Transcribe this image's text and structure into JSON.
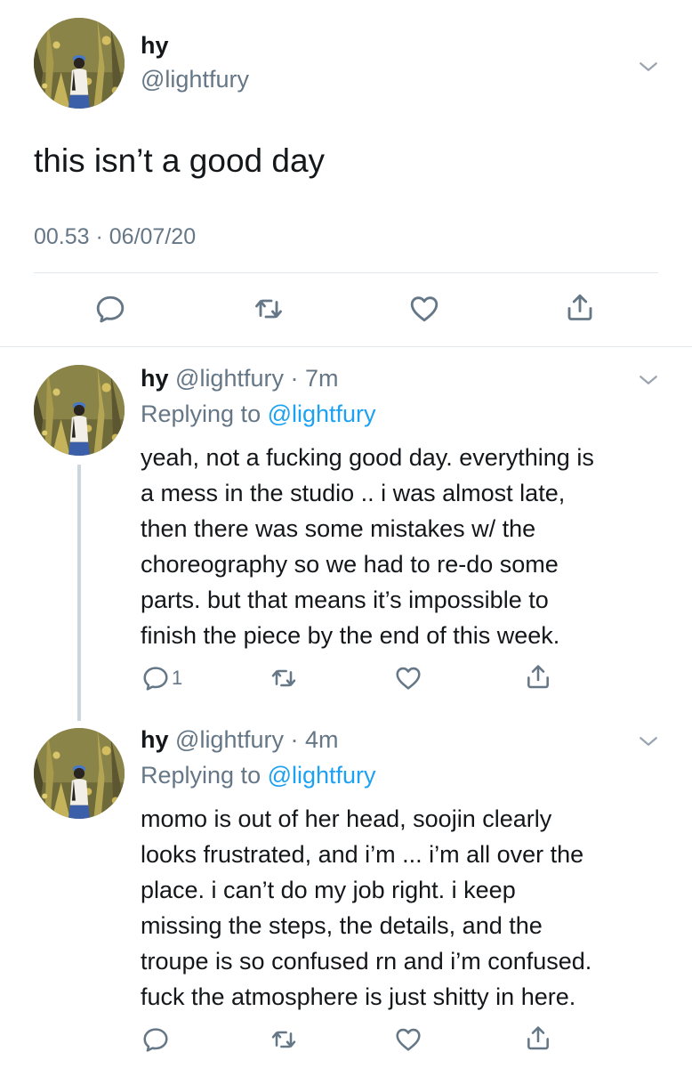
{
  "main_tweet": {
    "display_name": "hy",
    "handle": "@lightfury",
    "text": "this isn’t a good day",
    "timestamp": "00.53 · 06/07/20"
  },
  "replies": [
    {
      "display_name": "hy",
      "handle": "@lightfury",
      "age": "7m",
      "replying_prefix": "Replying to ",
      "replying_to": "@lightfury",
      "text": "yeah, not a fucking good day. everything is\na mess in the studio .. i was almost late,\nthen there was some mistakes w/ the\nchoreography so we had to re-do some\nparts. but that means it’s impossible to\nfinish the piece by the end of this week.",
      "reply_count": "1"
    },
    {
      "display_name": "hy",
      "handle": "@lightfury",
      "age": "4m",
      "replying_prefix": "Replying to ",
      "replying_to": "@lightfury",
      "text": "momo is out of her head, soojin clearly\nlooks frustrated, and i’m ... i’m all over the\nplace. i can’t do my job right. i keep\nmissing the steps, the details, and the\ntroupe is so confused rn and i’m confused.\nfuck the atmosphere is just shitty in here.",
      "reply_count": ""
    }
  ],
  "separator": " · ",
  "icons": {
    "menu": "chevron-down-icon",
    "reply": "reply-icon",
    "retweet": "retweet-icon",
    "like": "heart-icon",
    "share": "share-icon"
  },
  "colors": {
    "text": "#14171a",
    "muted": "#657786",
    "link": "#1da1f2",
    "divider": "#e1e8ed",
    "thread_line": "#ccd6dd"
  }
}
